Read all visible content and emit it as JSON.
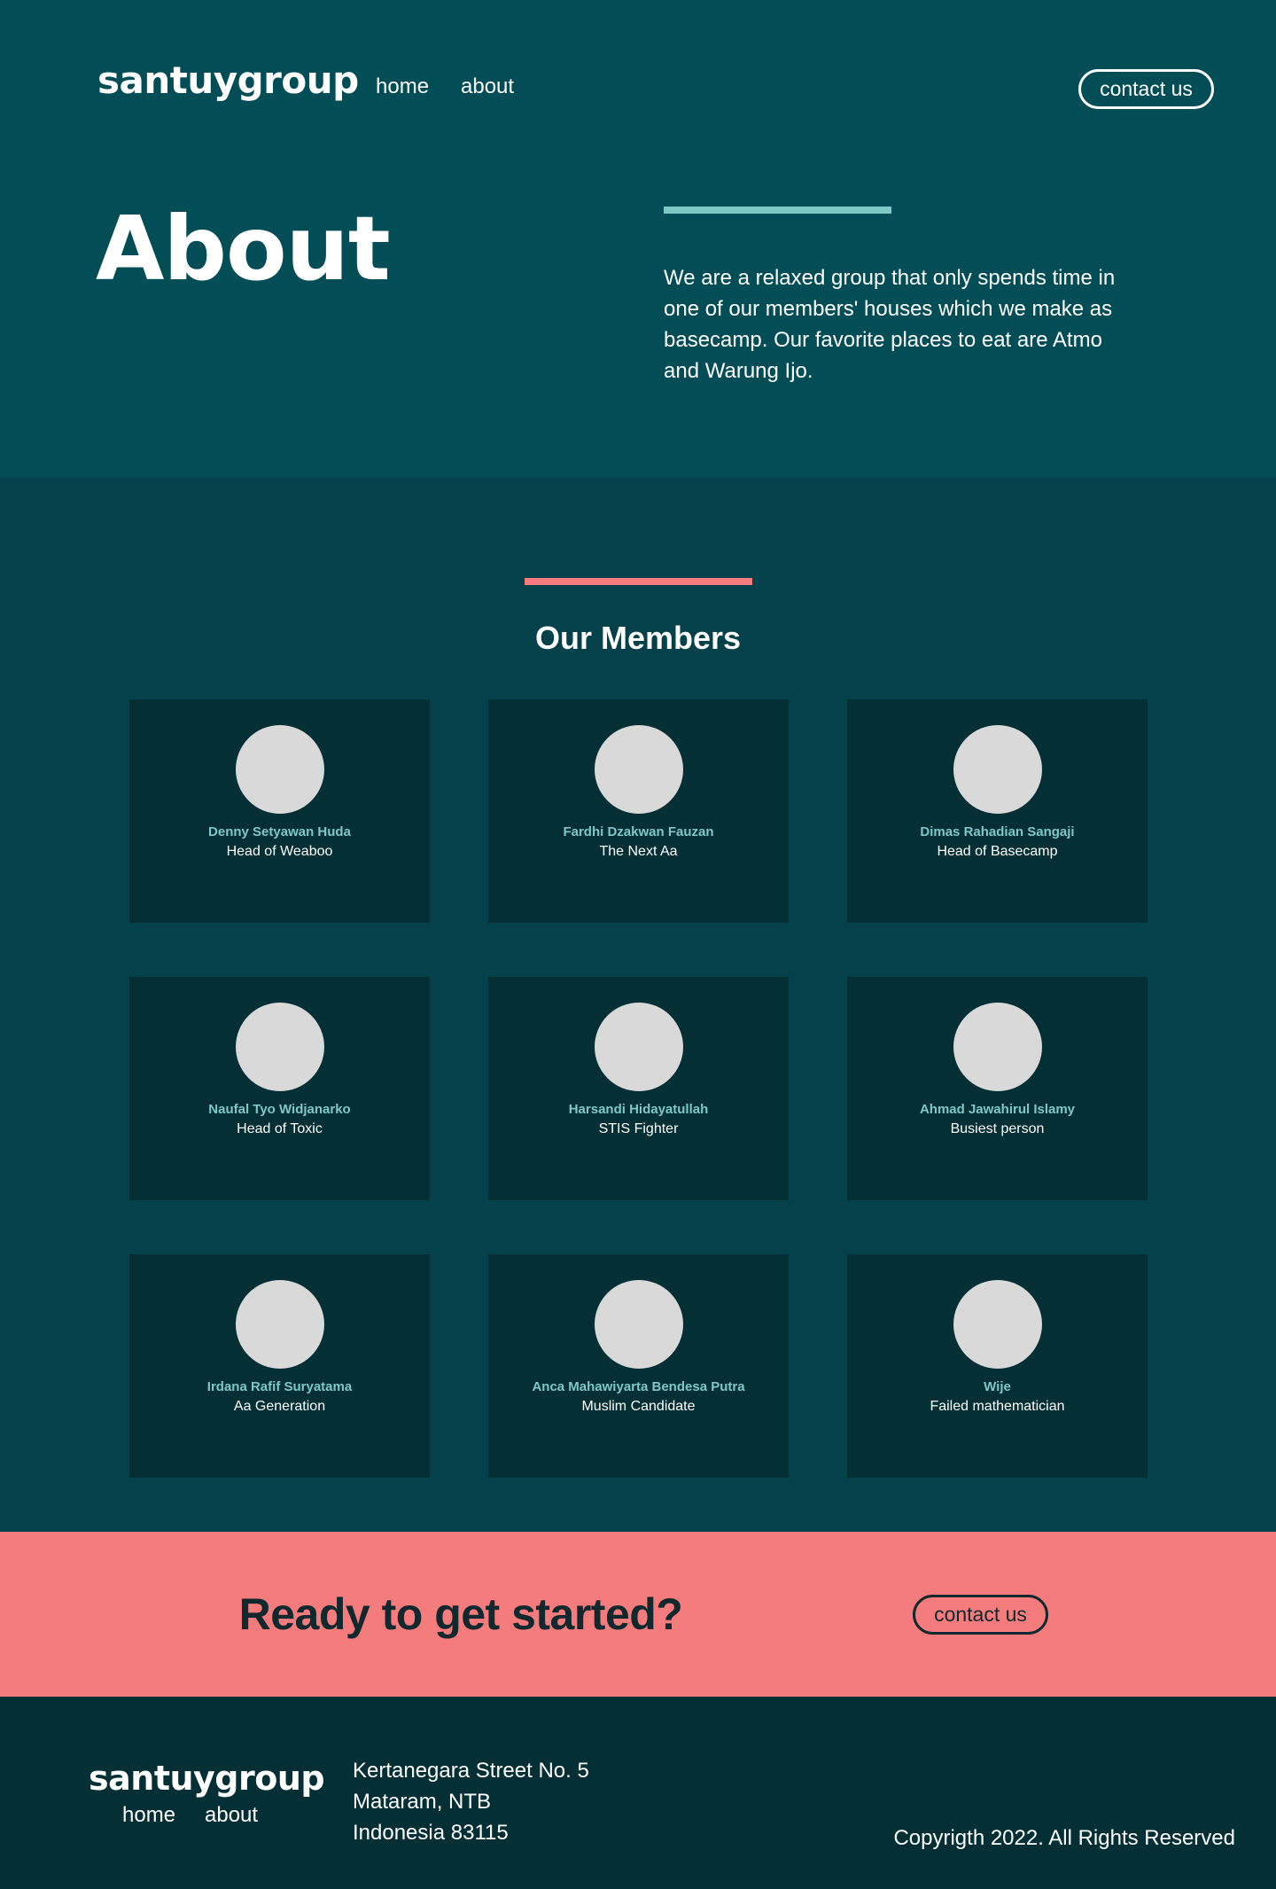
{
  "header": {
    "logo": "santuygroup",
    "nav": {
      "home": "home",
      "about": "about"
    },
    "contact_label": "contact us"
  },
  "hero": {
    "title": "About",
    "description": "We are a relaxed group that only spends time in one of our members' houses which we make as basecamp. Our favorite places to eat are Atmo and Warung Ijo."
  },
  "members": {
    "title": "Our Members",
    "list": [
      {
        "name": "Denny Setyawan Huda",
        "role": "Head of Weaboo"
      },
      {
        "name": "Fardhi Dzakwan Fauzan",
        "role": "The Next Aa"
      },
      {
        "name": "Dimas Rahadian Sangaji",
        "role": "Head of Basecamp"
      },
      {
        "name": "Naufal Tyo Widjanarko",
        "role": "Head of Toxic"
      },
      {
        "name": "Harsandi Hidayatullah",
        "role": "STIS Fighter"
      },
      {
        "name": "Ahmad Jawahirul Islamy",
        "role": "Busiest person"
      },
      {
        "name": "Irdana Rafif Suryatama",
        "role": "Aa Generation"
      },
      {
        "name": "Anca Mahawiyarta Bendesa Putra",
        "role": "Muslim Candidate"
      },
      {
        "name": "Wije",
        "role": "Failed mathematician"
      }
    ]
  },
  "cta": {
    "title": "Ready to get started?",
    "button_label": "contact us"
  },
  "footer": {
    "logo": "santuygroup",
    "nav": {
      "home": "home",
      "about": "about"
    },
    "address": [
      "Kertanegara Street No. 5",
      "Mataram, NTB",
      "Indonesia 83115"
    ],
    "copyright": "Copyrigth 2022. All Rights Reserved"
  },
  "colors": {
    "hero_bg": "#034e56",
    "members_bg": "#04414a",
    "card_bg": "#032f35",
    "accent_teal": "#7ec8c8",
    "accent_coral": "#f47c7c",
    "dark_text": "#11282e",
    "avatar_placeholder": "#d9d9d9"
  }
}
